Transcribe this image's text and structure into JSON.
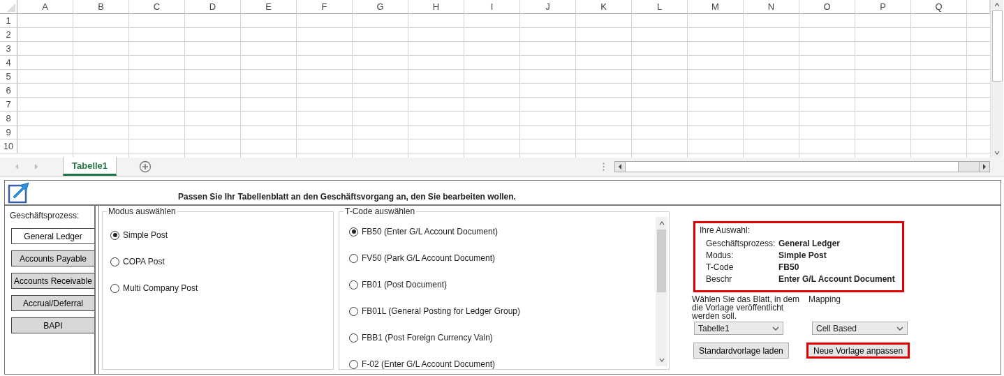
{
  "sheet": {
    "columns": [
      "A",
      "B",
      "C",
      "D",
      "E",
      "F",
      "G",
      "H",
      "I",
      "J",
      "K",
      "L",
      "M",
      "N",
      "O",
      "P",
      "Q"
    ],
    "rows": [
      "1",
      "2",
      "3",
      "4",
      "5",
      "6",
      "7",
      "8",
      "9",
      "10"
    ]
  },
  "sheet_tabs": [
    {
      "label": "Tabelle1",
      "selected": true
    }
  ],
  "form": {
    "title": "Passen Sie Ihr Tabellenblatt an den Geschäftsvorgang an, den Sie bearbeiten wollen.",
    "process_label": "Geschäftsprozess:",
    "processes": [
      {
        "label": "General Ledger",
        "selected": true
      },
      {
        "label": "Accounts Payable",
        "selected": false
      },
      {
        "label": "Accounts Receivable",
        "selected": false
      },
      {
        "label": "Accrual/Deferral",
        "selected": false
      },
      {
        "label": "BAPI",
        "selected": false
      }
    ],
    "mode_group": {
      "legend": "Modus auswählen",
      "options": [
        {
          "label": "Simple Post",
          "selected": true
        },
        {
          "label": "COPA Post",
          "selected": false
        },
        {
          "label": "Multi Company Post",
          "selected": false
        }
      ]
    },
    "tcode_group": {
      "legend": "T-Code auswählen",
      "options": [
        {
          "label": "FB50 (Enter G/L Account Document)",
          "selected": true
        },
        {
          "label": "FV50 (Park G/L Account Document)",
          "selected": false
        },
        {
          "label": "FB01 (Post Document)",
          "selected": false
        },
        {
          "label": "FB01L (General Posting for Ledger Group)",
          "selected": false
        },
        {
          "label": "FBB1 (Post Foreign Currency Valn)",
          "selected": false
        },
        {
          "label": "F-02 (Enter G/L Account Document)",
          "selected": false
        }
      ]
    },
    "summary": {
      "heading": "Ihre Auswahl:",
      "rows": [
        {
          "label": "Geschäftsprozess:",
          "value": "General Ledger"
        },
        {
          "label": "Modus:",
          "value": "Simple Post"
        },
        {
          "label": "T-Code",
          "value": "FB50"
        },
        {
          "label": "Beschr",
          "value": "Enter G/L Account Document"
        }
      ]
    },
    "sheet_prompt": "Wählen Sie das Blatt, in dem die Vorlage veröffentlicht werden soll.",
    "mapping_label": "Mapping",
    "sheet_select": {
      "value": "Tabelle1"
    },
    "mapping_select": {
      "value": "Cell Based"
    },
    "buttons": [
      {
        "label": "Standardvorlage laden",
        "highlighted": false
      },
      {
        "label": "Neue Vorlage anpassen",
        "highlighted": true
      }
    ]
  }
}
